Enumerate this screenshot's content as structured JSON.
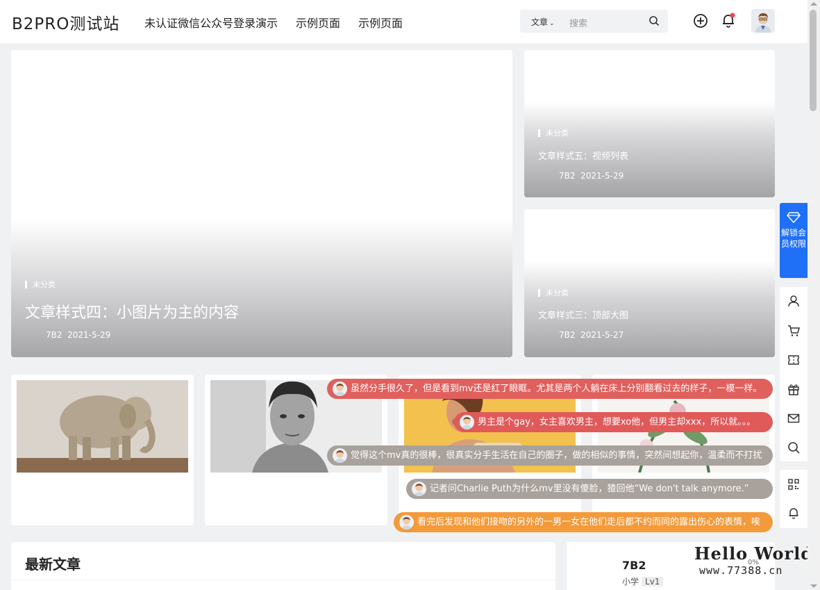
{
  "header": {
    "logo": "B2PRO测试站",
    "nav": [
      "未认证微信公众号登录演示",
      "示例页面",
      "示例页面"
    ],
    "search_type": "文章",
    "search_placeholder": "搜索"
  },
  "hero": {
    "big": {
      "category": "未分类",
      "title": "文章样式四：小图片为主的内容",
      "author": "7B2",
      "date": "2021-5-29"
    },
    "side": [
      {
        "category": "未分类",
        "title": "文章样式五：视频列表",
        "author": "7B2",
        "date": "2021-5-29"
      },
      {
        "category": "未分类",
        "title": "文章样式三：顶部大图",
        "author": "7B2",
        "date": "2021-5-27"
      }
    ]
  },
  "vip": {
    "label": "解锁会员权限"
  },
  "danmaku": [
    {
      "text": "虽然分手很久了，但是看到mv还是红了眼眶。尤其是两个人躺在床上分别翻看过去的样子，一模一样。",
      "color": "#e0605d"
    },
    {
      "text": "男主是个gay，女主喜欢男主，想要xo他，但男主却xxx，所以就。。。",
      "color": "#e05a5a"
    },
    {
      "text": "觉得这个mv真的很棒，很真实分手生活在自己的圈子，做的相似的事情，突然间想起你，温柔而不打扰",
      "color": "#a8a19c"
    },
    {
      "text": "记者问Charlie Puth为什么mv里没有傻脸，猹回他“We don't talk anymore.”",
      "color": "#a8a19c"
    },
    {
      "text": "看完后发现和他们接吻的另外的一男一女在他们走后都不约而同的露出伤心的表情，唉",
      "color": "#f39a3a"
    }
  ],
  "latest": {
    "title": "最新文章"
  },
  "user": {
    "name": "7B2",
    "level_label": "小学",
    "level": "Lv1"
  },
  "watermark": {
    "line1": "Hello World",
    "line2": "www.77388.cn",
    "percent": "0%"
  }
}
